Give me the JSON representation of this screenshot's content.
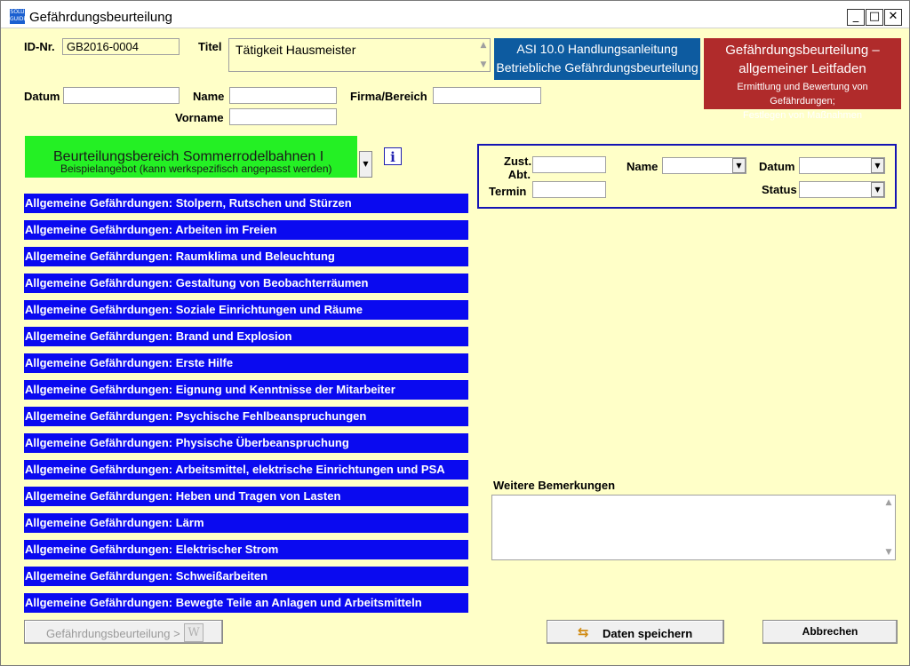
{
  "window": {
    "title": "Gefährdungsbeurteilung",
    "icon": "app-icon",
    "controls": {
      "minimize": "_",
      "maximize": "□",
      "close": "✕"
    }
  },
  "form": {
    "id_label": "ID-Nr.",
    "id_value": "GB2016-0004",
    "titel_label": "Titel",
    "titel_value": "Tätigkeit Hausmeister",
    "datum_label": "Datum",
    "datum_value": "",
    "name_label": "Name",
    "name_value": "",
    "vorname_label": "Vorname",
    "vorname_value": "",
    "firma_label": "Firma/Bereich",
    "firma_value": ""
  },
  "buttons": {
    "asi_line1": "ASI 10.0  Handlungsanleitung",
    "asi_line2": "Betriebliche Gefährdungsbeurteilung",
    "leitfaden_line1": "Gefährdungsbeurteilung –",
    "leitfaden_line2": "allgemeiner Leitfaden",
    "leitfaden_sub1": "Ermittlung und Bewertung von Gefährdungen;",
    "leitfaden_sub2": "Festlegen von Maßnahmen"
  },
  "bereich": {
    "selected": "Beurteilungsbereich Sommerrodelbahnen I",
    "subtext": "Beispielangebot (kann werkspezifisch angepasst werden)",
    "info_icon": "info-icon"
  },
  "assignment": {
    "zust_label": "Zust. Abt.",
    "zust_value": "",
    "termin_label": "Termin",
    "termin_value": "",
    "name_label": "Name",
    "name_value": "",
    "datum_label": "Datum",
    "datum_value": "",
    "status_label": "Status",
    "status_value": ""
  },
  "hazards": [
    "Allgemeine Gefährdungen: Stolpern, Rutschen und Stürzen",
    "Allgemeine Gefährdungen: Arbeiten im Freien",
    "Allgemeine Gefährdungen: Raumklima und Beleuchtung",
    "Allgemeine Gefährdungen: Gestaltung von Beobachterräumen",
    "Allgemeine Gefährdungen: Soziale Einrichtungen und Räume",
    "Allgemeine Gefährdungen: Brand und Explosion",
    "Allgemeine Gefährdungen: Erste Hilfe",
    "Allgemeine Gefährdungen: Eignung und Kenntnisse der Mitarbeiter",
    "Allgemeine Gefährdungen: Psychische Fehlbeanspruchungen",
    "Allgemeine Gefährdungen: Physische Überbeanspruchung",
    "Allgemeine Gefährdungen: Arbeitsmittel, elektrische Einrichtungen und PSA",
    "Allgemeine Gefährdungen: Heben und Tragen von Lasten",
    "Allgemeine Gefährdungen: Lärm",
    "Allgemeine Gefährdungen: Elektrischer Strom",
    "Allgemeine Gefährdungen: Schweißarbeiten",
    "Allgemeine Gefährdungen: Bewegte Teile an Anlagen und Arbeitsmitteln"
  ],
  "remarks": {
    "label": "Weitere Bemerkungen",
    "value": ""
  },
  "footer": {
    "export_label": "Gefährdungsbeurteilung  >",
    "export_icon": "word-icon",
    "save_label": "Daten speichern",
    "save_icon": "save-arrows-icon",
    "cancel_label": "Abbrechen"
  },
  "colors": {
    "background": "#ffffc8",
    "hazard_button": "#0a0af0",
    "green_combo": "#24f024",
    "asi_button": "#0d5ba0",
    "leitfaden_button": "#b02b2b",
    "panel_border": "#1414b4"
  }
}
